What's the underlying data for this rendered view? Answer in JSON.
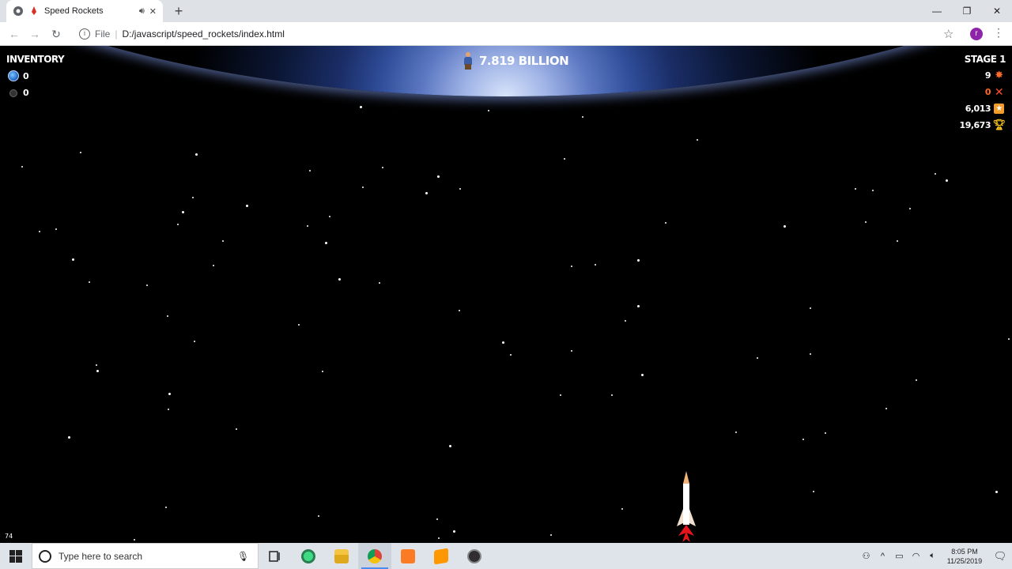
{
  "browser": {
    "tab_title": "Speed Rockets",
    "new_tab_label": "+",
    "address_scheme": "File",
    "address_url": "D:/javascript/speed_rockets/index.html",
    "profile_initial": "r",
    "window_controls": {
      "minimize": "—",
      "maximize": "❐",
      "close": "✕"
    }
  },
  "game": {
    "inventory_title": "INVENTORY",
    "inventory": {
      "shields": "0",
      "bombs": "0"
    },
    "population": "7.819 BILLION",
    "stage": "STAGE 1",
    "stats": {
      "hits": "9",
      "misses": "0",
      "score": "6,013",
      "high_score": "19,673"
    },
    "fps": "74",
    "colors": {
      "explosion": "#ff6a2a",
      "miss": "#ff4d2e",
      "trophy": "#f7c21a",
      "rocket_flame": "#e8141c"
    },
    "icons": [
      "shield-icon",
      "bomb-icon",
      "person-icon",
      "explosion-icon",
      "miss-x-icon",
      "score-icon",
      "trophy-icon"
    ]
  },
  "taskbar": {
    "search_placeholder": "Type here to search",
    "clock_time": "8:05 PM",
    "clock_date": "11/25/2019",
    "apps": [
      "task-view-icon",
      "android-studio-icon",
      "file-explorer-icon",
      "chrome-icon",
      "xampp-icon",
      "sublime-text-icon",
      "obs-icon"
    ]
  }
}
